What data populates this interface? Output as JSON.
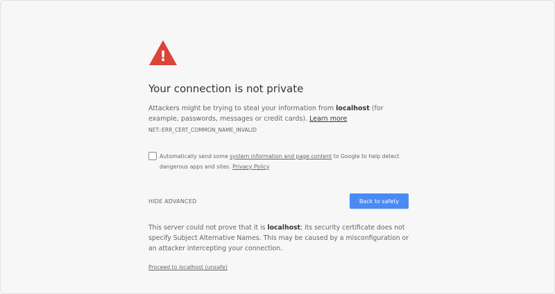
{
  "page": {
    "title": "Your connection is not private",
    "background_color": "#f7f7f7",
    "warning_color": "#db4437",
    "button_color": "#4a8af4"
  },
  "icon": {
    "name": "warning-triangle-icon",
    "glyph": "!"
  },
  "message": {
    "prefix": "Attackers might be trying to steal your information from ",
    "host": "localhost",
    "suffix": " (for example, passwords, messages or credit cards). ",
    "learn_more_label": "Learn more"
  },
  "error_code": "NET::ERR_CERT_COMMON_NAME_INVALID",
  "checkbox": {
    "checked": false,
    "text_prefix": "Automatically send some ",
    "link_label": "system information and page content",
    "text_middle": " to Google to help detect dangerous apps and sites. ",
    "privacy_label": "Privacy Policy"
  },
  "actions": {
    "hide_advanced_label": "HIDE ADVANCED",
    "back_to_safety_label": "Back to safety"
  },
  "details": {
    "prefix": "This server could not prove that it is ",
    "host": "localhost",
    "suffix": "; its security certificate does not specify Subject Alternative Names. This may be caused by a misconfiguration or an attacker intercepting your connection."
  },
  "proceed_link_label": "Proceed to localhost (unsafe)"
}
